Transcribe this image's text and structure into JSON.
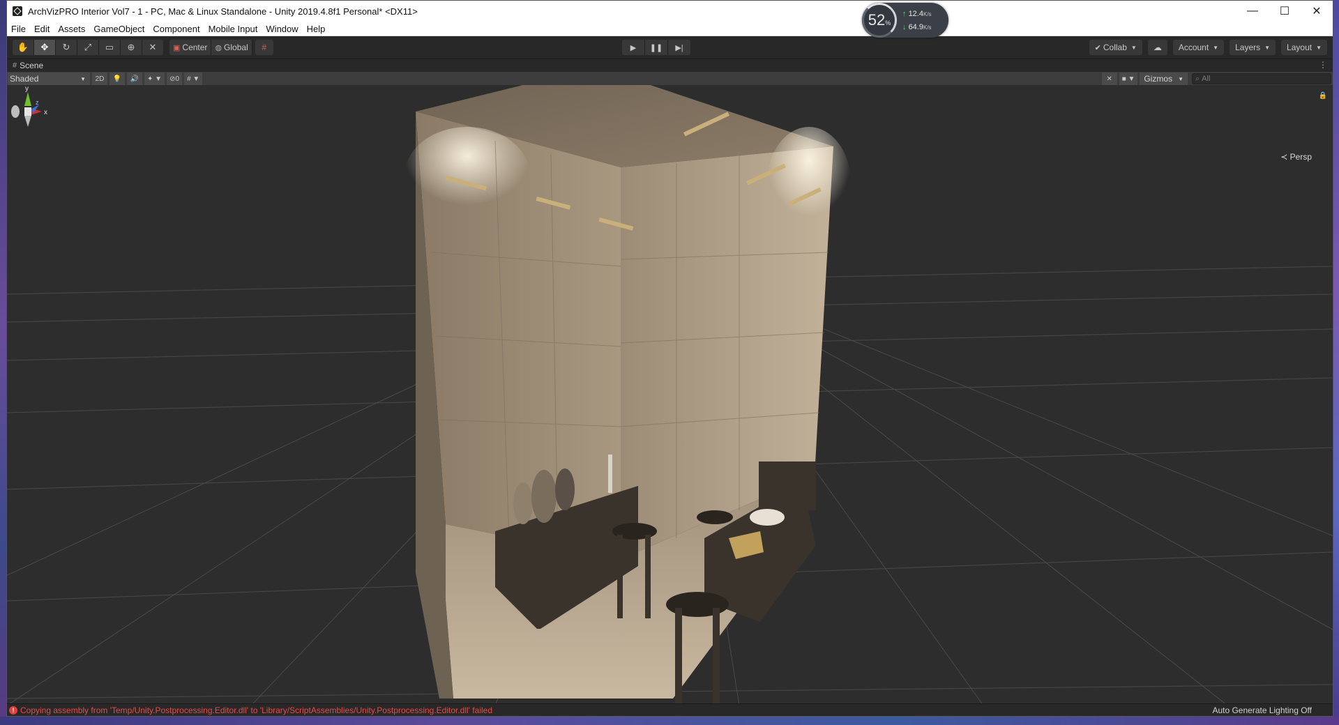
{
  "window": {
    "title": "ArchVizPRO Interior Vol7 - 1 - PC, Mac & Linux Standalone - Unity 2019.4.8f1 Personal* <DX11>",
    "controls": {
      "minimize": "—",
      "maximize": "☐",
      "close": "✕"
    }
  },
  "perf_widget": {
    "percent": "52",
    "percent_unit": "%",
    "upload": "12.4",
    "download": "64.9",
    "rate_unit": "K/s"
  },
  "menu": [
    "File",
    "Edit",
    "Assets",
    "GameObject",
    "Component",
    "Mobile Input",
    "Window",
    "Help"
  ],
  "toolbar": {
    "transform_tools": [
      "hand-tool",
      "move-tool",
      "rotate-tool",
      "scale-tool",
      "rect-tool",
      "transform-tool",
      "custom-tool"
    ],
    "active_tool": "move-tool",
    "pivot_label": "Center",
    "space_label": "Global",
    "collab_label": "Collab",
    "account_label": "Account",
    "layers_label": "Layers",
    "layout_label": "Layout"
  },
  "scene_tab": {
    "label": "Scene",
    "shading_mode": "Shaded",
    "mode_2d": "2D",
    "hidden_count": "0",
    "gizmos_label": "Gizmos",
    "search_placeholder": "All"
  },
  "viewport": {
    "projection_label": "Persp",
    "axis_labels": {
      "x": "x",
      "y": "y",
      "z": "z"
    }
  },
  "status": {
    "error_message": "Copying assembly from 'Temp/Unity.Postprocessing.Editor.dll' to 'Library/ScriptAssemblies/Unity.Postprocessing.Editor.dll' failed",
    "lighting": "Auto Generate Lighting Off"
  },
  "colors": {
    "editor_bg": "#282828",
    "viewport_bg": "#2d2d2d",
    "error_red": "#e84b4b",
    "axis_x": "#d03030",
    "axis_y": "#6fc02f",
    "axis_z": "#3b6ed8"
  }
}
